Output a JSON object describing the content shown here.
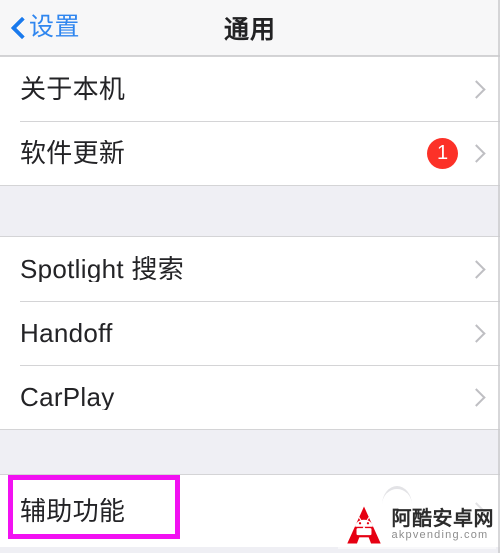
{
  "navbar": {
    "back_label": "设置",
    "back_icon": "chevron-left-icon",
    "title": "通用"
  },
  "groups": [
    {
      "id": "device-group",
      "rows": [
        {
          "label": "关于本机",
          "badge": null,
          "chevron": "chevron-right-icon"
        },
        {
          "label": "软件更新",
          "badge": "1",
          "chevron": "chevron-right-icon"
        }
      ]
    },
    {
      "id": "features-group",
      "rows": [
        {
          "label": "Spotlight 搜索",
          "badge": null,
          "chevron": "chevron-right-icon"
        },
        {
          "label": "Handoff",
          "badge": null,
          "chevron": "chevron-right-icon"
        },
        {
          "label": "CarPlay",
          "badge": null,
          "chevron": "chevron-right-icon"
        }
      ]
    },
    {
      "id": "accessibility-group",
      "rows": [
        {
          "label": "辅助功能",
          "badge": null,
          "chevron": "chevron-right-icon"
        }
      ]
    }
  ],
  "annotation": {
    "type": "highlight-rectangle",
    "target": "辅助功能",
    "color": "#f211f2"
  },
  "watermark": {
    "site_name": "阿酷安卓网",
    "url": "akpvending.com",
    "logo": "red-a-android-logo",
    "logo_color": "#e60012"
  },
  "colors": {
    "accent_blue": "#2f86ef",
    "badge_red": "#fc3128",
    "list_background": "#efeff4",
    "row_background": "#ffffff",
    "separator": "#d4d4d6",
    "chevron_gray": "#bfbfc3",
    "highlight_magenta": "#f211f2"
  }
}
